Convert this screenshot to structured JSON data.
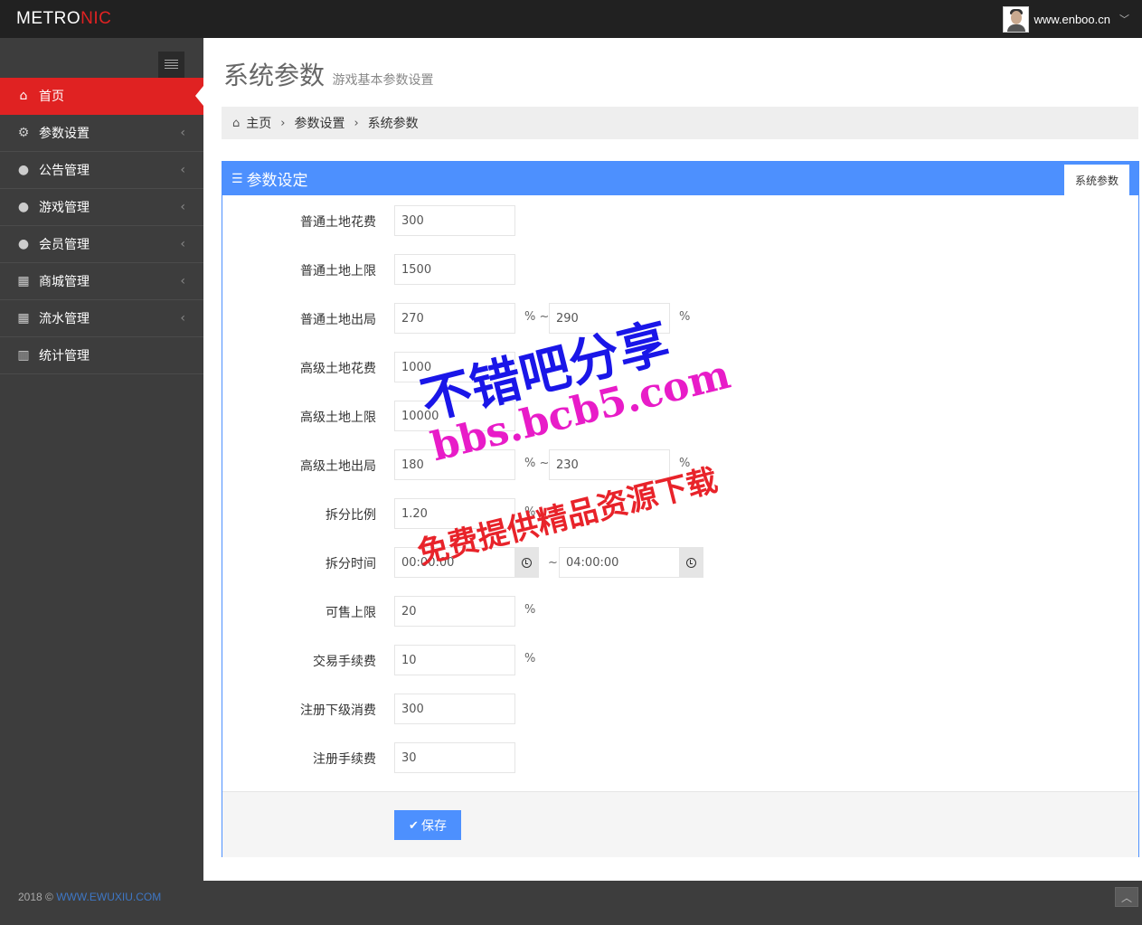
{
  "header": {
    "logo_main": "METRO",
    "logo_accent": "NIC",
    "username": "www.enboo.cn",
    "caret": "﹀"
  },
  "sidebar": {
    "items": [
      {
        "label": "首页",
        "icon": "home-icon",
        "glyph": "⌂"
      },
      {
        "label": "参数设置",
        "icon": "gears-icon",
        "glyph": "⚙"
      },
      {
        "label": "公告管理",
        "icon": "user-icon",
        "glyph": "●"
      },
      {
        "label": "游戏管理",
        "icon": "user-icon",
        "glyph": "●"
      },
      {
        "label": "会员管理",
        "icon": "user-icon",
        "glyph": "●"
      },
      {
        "label": "商城管理",
        "icon": "table-icon",
        "glyph": "▦"
      },
      {
        "label": "流水管理",
        "icon": "table-icon",
        "glyph": "▦"
      },
      {
        "label": "统计管理",
        "icon": "bar-chart-icon",
        "glyph": "▥"
      }
    ],
    "arrow": "‹"
  },
  "page": {
    "title": "系统参数",
    "subtitle": "游戏基本参数设置"
  },
  "breadcrumb": {
    "home": "主页",
    "level2": "参数设置",
    "level3": "系统参数",
    "sep": "›"
  },
  "portlet": {
    "title": "参数设定",
    "tab": "系统参数"
  },
  "form": {
    "normal_land_cost": {
      "label": "普通土地花费",
      "value": "300"
    },
    "normal_land_limit": {
      "label": "普通土地上限",
      "value": "1500"
    },
    "normal_land_out": {
      "label": "普通土地出局",
      "min": "270",
      "max": "290",
      "unit_mid": "% ~",
      "unit_end": "%"
    },
    "advanced_land_cost": {
      "label": "高级土地花费",
      "value": "1000"
    },
    "advanced_land_limit": {
      "label": "高级土地上限",
      "value": "10000"
    },
    "advanced_land_out": {
      "label": "高级土地出局",
      "min": "180",
      "max": "230",
      "unit_mid": "% ~",
      "unit_end": "%"
    },
    "split_ratio": {
      "label": "拆分比例",
      "value": "1.20",
      "unit": "%"
    },
    "split_time": {
      "label": "拆分时间",
      "start": "00:00:00",
      "end": "04:00:00",
      "sep": "~"
    },
    "sell_limit": {
      "label": "可售上限",
      "value": "20",
      "unit": "%"
    },
    "trade_fee": {
      "label": "交易手续费",
      "value": "10",
      "unit": "%"
    },
    "register_sub_cost": {
      "label": "注册下级消费",
      "value": "300"
    },
    "register_fee": {
      "label": "注册手续费",
      "value": "30"
    },
    "save_label": "保存"
  },
  "watermark": {
    "line1": "不错吧分享",
    "line2": "bbs.bcb5.com",
    "line3": "免费提供精品资源下载"
  },
  "footer": {
    "copyright": "2018 ©",
    "link": "WWW.EWUXIU.COM",
    "go_top": "︿"
  },
  "colors": {
    "accent_red": "#e02222",
    "accent_blue": "#4d90fe",
    "sidebar_bg": "#3d3d3d",
    "header_bg": "#212121"
  }
}
